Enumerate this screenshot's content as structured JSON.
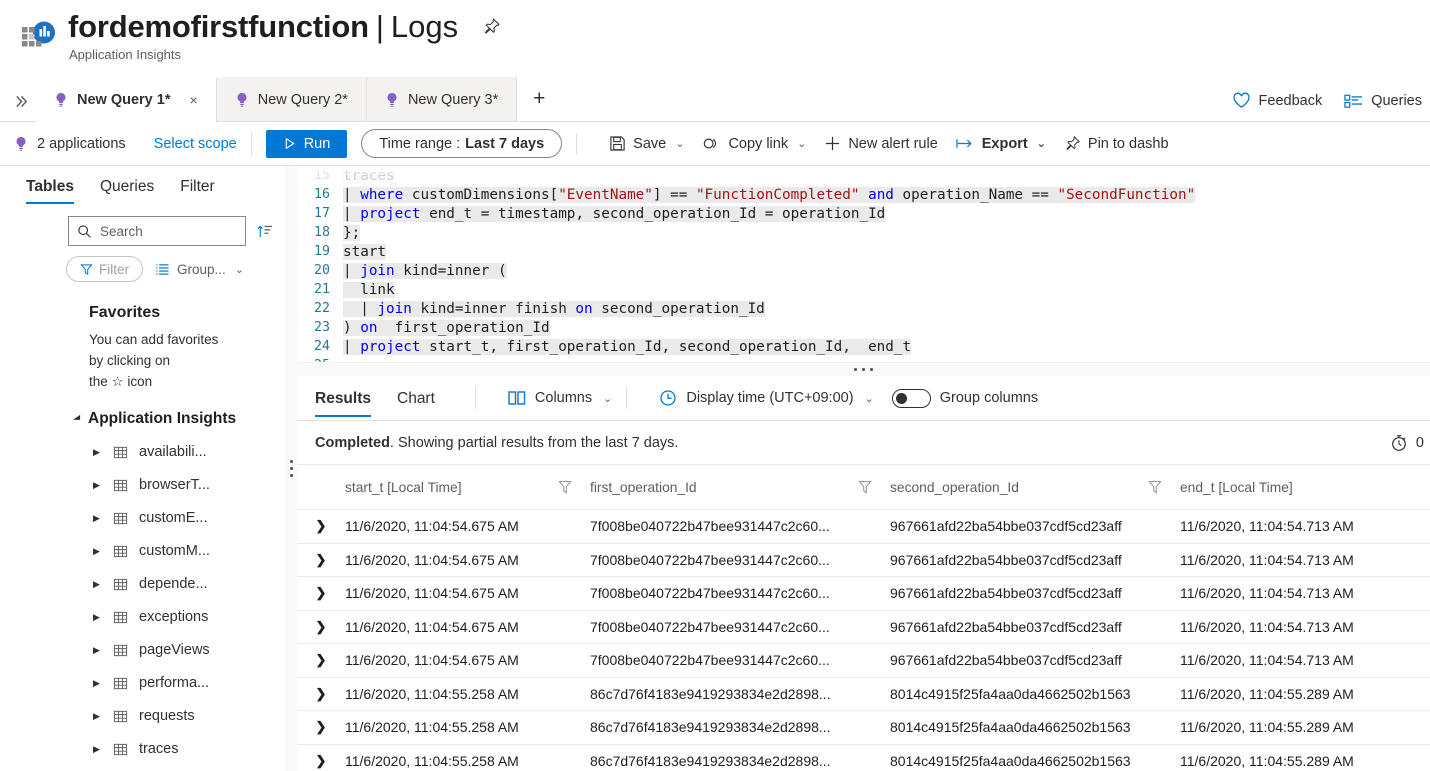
{
  "header": {
    "title": "fordemofirstfunction",
    "separator": "|",
    "section": "Logs",
    "subtitle": "Application Insights",
    "pin_icon": "pin-icon",
    "logo_icon": "application-insights-logo"
  },
  "tabstrip": {
    "expand_icon": "chevron-double-right-icon",
    "tabs": [
      {
        "label": "New Query 1*",
        "icon": "query-bulb-icon",
        "active": true,
        "close": "×"
      },
      {
        "label": "New Query 2*",
        "icon": "query-bulb-icon",
        "active": false
      },
      {
        "label": "New Query 3*",
        "icon": "query-bulb-icon",
        "active": false
      }
    ],
    "add_label": "+",
    "right_items": [
      {
        "label": "Feedback",
        "icon": "heart-icon"
      },
      {
        "label": "Queries",
        "icon": "queries-list-icon"
      }
    ]
  },
  "commandbar": {
    "scope_label": "2 applications",
    "scope_icon": "query-bulb-icon",
    "select_scope_label": "Select scope",
    "run_label": "Run",
    "run_icon": "play-icon",
    "time_range_prefix": "Time range :",
    "time_range_value": "Last 7 days",
    "items": [
      {
        "label": "Save",
        "icon": "save-icon",
        "caret": true,
        "bold": false
      },
      {
        "label": "Copy link",
        "icon": "link-icon",
        "caret": true,
        "bold": false
      },
      {
        "label": "New alert rule",
        "icon": "plus-icon",
        "caret": false,
        "bold": false
      },
      {
        "label": "Export",
        "icon": "export-icon",
        "caret": true,
        "bold": true
      },
      {
        "label": "Pin to dashb",
        "icon": "pin-icon",
        "caret": false,
        "bold": false
      }
    ]
  },
  "sidebar": {
    "tabs": [
      {
        "label": "Tables",
        "active": true
      },
      {
        "label": "Queries",
        "active": false
      },
      {
        "label": "Filter",
        "active": false
      }
    ],
    "search_placeholder": "Search",
    "search_value": "",
    "search_icon": "search-icon",
    "sort_icon": "sort-icon",
    "filter_pill_label": "Filter",
    "filter_pill_icon": "funnel-icon",
    "group_label": "Group...",
    "group_icon": "group-list-icon",
    "favorites_title": "Favorites",
    "favorites_text_lines": [
      "You can add favorites",
      "by clicking on",
      "the ☆ icon"
    ],
    "group_header": "Application Insights",
    "group_header_icon": "triangle-down-icon",
    "tables": [
      "availabili...",
      "browserT...",
      "customE...",
      "customM...",
      "depende...",
      "exceptions",
      "pageViews",
      "performa...",
      "requests",
      "traces"
    ],
    "table_icon": "table-icon",
    "expand_icon": "triangle-right-icon"
  },
  "editor": {
    "lines": [
      {
        "num": "15",
        "cut": true,
        "tokens": [
          {
            "t": "traces",
            "c": "hl"
          }
        ]
      },
      {
        "num": "16",
        "tokens": [
          {
            "t": "| ",
            "c": "txt"
          },
          {
            "t": "where",
            "c": "kw"
          },
          {
            "t": " customDimensions[",
            "c": "txt"
          },
          {
            "t": "\"EventName\"",
            "c": "str"
          },
          {
            "t": "] == ",
            "c": "txt"
          },
          {
            "t": "\"FunctionCompleted\"",
            "c": "str"
          },
          {
            "t": " ",
            "c": "txt"
          },
          {
            "t": "and",
            "c": "kw"
          },
          {
            "t": " operation_Name == ",
            "c": "txt"
          },
          {
            "t": "\"SecondFunction\"",
            "c": "str"
          }
        ]
      },
      {
        "num": "17",
        "tokens": [
          {
            "t": "| ",
            "c": "txt"
          },
          {
            "t": "project",
            "c": "kw"
          },
          {
            "t": " end_t = timestamp, second_operation_Id = operation_Id",
            "c": "txt"
          }
        ]
      },
      {
        "num": "18",
        "tokens": [
          {
            "t": "};",
            "c": "txt"
          }
        ]
      },
      {
        "num": "19",
        "tokens": [
          {
            "t": "start",
            "c": "txt"
          }
        ]
      },
      {
        "num": "20",
        "tokens": [
          {
            "t": "| ",
            "c": "txt"
          },
          {
            "t": "join",
            "c": "kw"
          },
          {
            "t": " kind=inner (",
            "c": "txt"
          }
        ]
      },
      {
        "num": "21",
        "tokens": [
          {
            "t": "  link",
            "c": "txt"
          }
        ]
      },
      {
        "num": "22",
        "tokens": [
          {
            "t": "  | ",
            "c": "txt"
          },
          {
            "t": "join",
            "c": "kw"
          },
          {
            "t": " kind=inner finish ",
            "c": "txt"
          },
          {
            "t": "on",
            "c": "kw"
          },
          {
            "t": " second_operation_Id",
            "c": "txt"
          }
        ]
      },
      {
        "num": "23",
        "tokens": [
          {
            "t": ") ",
            "c": "txt"
          },
          {
            "t": "on",
            "c": "kw"
          },
          {
            "t": "  first_operation_Id",
            "c": "txt"
          }
        ]
      },
      {
        "num": "24",
        "tokens": [
          {
            "t": "| ",
            "c": "txt"
          },
          {
            "t": "project",
            "c": "kw"
          },
          {
            "t": " start_t, first_operation_Id, second_operation_Id,  end_t",
            "c": "txt"
          }
        ]
      },
      {
        "num": "25",
        "tokens": [
          {
            "t": "",
            "c": "txt"
          }
        ]
      }
    ]
  },
  "results": {
    "tabs": [
      {
        "label": "Results",
        "active": true
      },
      {
        "label": "Chart",
        "active": false
      }
    ],
    "columns_label": "Columns",
    "columns_icon": "columns-icon",
    "display_time_label": "Display time (UTC+09:00)",
    "display_time_icon": "clock-icon",
    "group_columns_label": "Group columns",
    "group_columns_toggle": "off",
    "status_bold": "Completed",
    "status_rest": ". Showing partial results from the last 7 days.",
    "timing_icon": "stopwatch-icon",
    "timing_text": "0",
    "grid": {
      "headers": [
        {
          "label": "start_t [Local Time]",
          "filter": true
        },
        {
          "label": "first_operation_Id",
          "filter": true
        },
        {
          "label": "second_operation_Id",
          "filter": true
        },
        {
          "label": "end_t [Local Time]",
          "filter": false
        }
      ],
      "expand_icon": "chevron-right-icon",
      "filter_icon": "funnel-icon",
      "rows": [
        [
          "11/6/2020, 11:04:54.675 AM",
          "7f008be040722b47bee931447c2c60...",
          "967661afd22ba54bbe037cdf5cd23aff",
          "11/6/2020, 11:04:54.713 AM"
        ],
        [
          "11/6/2020, 11:04:54.675 AM",
          "7f008be040722b47bee931447c2c60...",
          "967661afd22ba54bbe037cdf5cd23aff",
          "11/6/2020, 11:04:54.713 AM"
        ],
        [
          "11/6/2020, 11:04:54.675 AM",
          "7f008be040722b47bee931447c2c60...",
          "967661afd22ba54bbe037cdf5cd23aff",
          "11/6/2020, 11:04:54.713 AM"
        ],
        [
          "11/6/2020, 11:04:54.675 AM",
          "7f008be040722b47bee931447c2c60...",
          "967661afd22ba54bbe037cdf5cd23aff",
          "11/6/2020, 11:04:54.713 AM"
        ],
        [
          "11/6/2020, 11:04:54.675 AM",
          "7f008be040722b47bee931447c2c60...",
          "967661afd22ba54bbe037cdf5cd23aff",
          "11/6/2020, 11:04:54.713 AM"
        ],
        [
          "11/6/2020, 11:04:55.258 AM",
          "86c7d76f4183e9419293834e2d2898...",
          "8014c4915f25fa4aa0da4662502b1563",
          "11/6/2020, 11:04:55.289 AM"
        ],
        [
          "11/6/2020, 11:04:55.258 AM",
          "86c7d76f4183e9419293834e2d2898...",
          "8014c4915f25fa4aa0da4662502b1563",
          "11/6/2020, 11:04:55.289 AM"
        ],
        [
          "11/6/2020, 11:04:55.258 AM",
          "86c7d76f4183e9419293834e2d2898...",
          "8014c4915f25fa4aa0da4662502b1563",
          "11/6/2020, 11:04:55.289 AM"
        ]
      ]
    }
  },
  "colors": {
    "accent": "#0078d4",
    "tab_bulb": "#8661c5",
    "keyword": "#0000ff",
    "string": "#a31515",
    "line_number": "#237893"
  }
}
